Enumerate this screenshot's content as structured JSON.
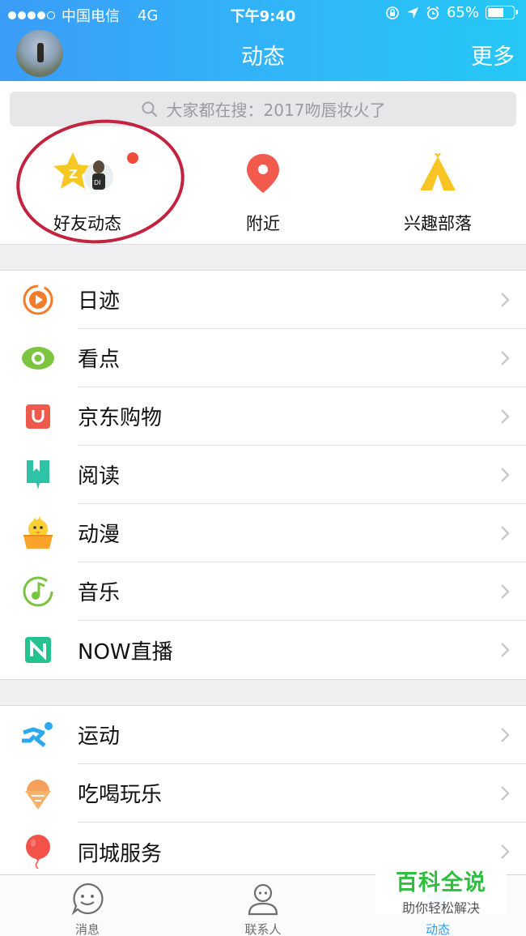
{
  "status_bar": {
    "carrier": "中国电信",
    "network": "4G",
    "time": "下午9:40",
    "battery": "65%",
    "battery_level": 0.65
  },
  "header": {
    "title": "动态",
    "more": "更多"
  },
  "search": {
    "placeholder": "大家都在搜：2017吻唇妆火了"
  },
  "top_items": [
    {
      "label": "好友动态",
      "icon": "friends-star-icon"
    },
    {
      "label": "附近",
      "icon": "location-pin-icon"
    },
    {
      "label": "兴趣部落",
      "icon": "tent-icon"
    }
  ],
  "group1": [
    {
      "label": "日迹",
      "icon": "play-circle-icon"
    },
    {
      "label": "看点",
      "icon": "eye-icon"
    },
    {
      "label": "京东购物",
      "icon": "shopping-bag-icon"
    },
    {
      "label": "阅读",
      "icon": "book-icon"
    },
    {
      "label": "动漫",
      "icon": "chick-icon"
    },
    {
      "label": "音乐",
      "icon": "music-note-icon"
    },
    {
      "label": "NOW直播",
      "icon": "now-live-icon"
    }
  ],
  "group2": [
    {
      "label": "运动",
      "icon": "runner-icon"
    },
    {
      "label": "吃喝玩乐",
      "icon": "ice-cream-icon"
    },
    {
      "label": "同城服务",
      "icon": "balloon-icon"
    }
  ],
  "tab_bar": [
    {
      "label": "消息",
      "icon": "smile-chat-icon",
      "active": false
    },
    {
      "label": "联系人",
      "icon": "person-icon",
      "active": false
    },
    {
      "label": "动态",
      "icon": "star-icon",
      "active": true
    }
  ],
  "watermark": {
    "line1": "百科全说",
    "line2": "助你轻松解决"
  },
  "colors": {
    "header_start": "#3a9cf7",
    "header_end": "#25c8f6",
    "active_tab": "#2d9df7",
    "annotation": "#c2243f"
  }
}
